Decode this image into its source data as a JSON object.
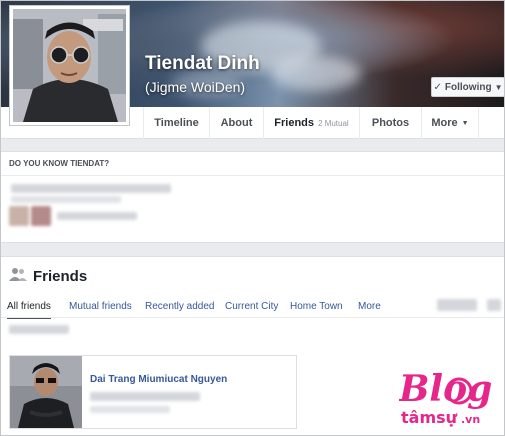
{
  "profile": {
    "name": "Tiendat Dinh",
    "alternate_name": "(Jigme WoiDen)",
    "follow_button": "Following"
  },
  "nav": {
    "items": [
      {
        "label": "Timeline"
      },
      {
        "label": "About"
      },
      {
        "label": "Friends",
        "sub": "2 Mutual"
      },
      {
        "label": "Photos"
      },
      {
        "label": "More"
      }
    ]
  },
  "know_card": {
    "title": "DO YOU KNOW TIENDAT?"
  },
  "friends_section": {
    "title": "Friends",
    "tabs": [
      "All friends",
      "Mutual friends",
      "Recently added",
      "Current City",
      "Home Town",
      "More"
    ],
    "active_tab": "All friends",
    "friends": [
      {
        "name": "Dai Trang Miumiucat Nguyen"
      }
    ]
  },
  "watermark": {
    "line1": "Blog",
    "line2": "tâmsự",
    "domain": ".vn"
  },
  "colors": {
    "link": "#365899",
    "watermark_pink": "#e6268a",
    "background": "#e9ebee"
  }
}
